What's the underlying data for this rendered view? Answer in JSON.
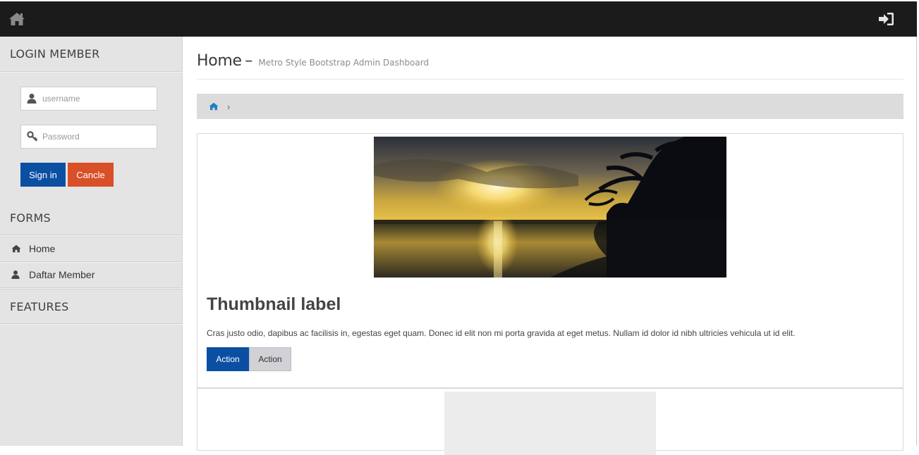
{
  "topbar": {
    "home_icon": "home-icon",
    "signin_icon": "sign-in-icon"
  },
  "sidebar": {
    "login_heading": "LOGIN MEMBER",
    "username_placeholder": "username",
    "password_placeholder": "Password",
    "signin_label": "Sign in",
    "cancel_label": "Cancle",
    "forms_heading": "FORMS",
    "items": [
      {
        "label": "Home",
        "icon": "home-icon"
      },
      {
        "label": "Daftar Member",
        "icon": "user-icon"
      }
    ],
    "features_heading": "FEATURES"
  },
  "main": {
    "title": "Home",
    "title_dash": "–",
    "subtitle": "Metro Style Bootstrap Admin Dashboard",
    "breadcrumb_sep": "›",
    "thumbnail": {
      "label": "Thumbnail label",
      "text": "Cras justo odio, dapibus ac facilisis in, egestas eget quam. Donec id elit non mi porta gravida at eget metus. Nullam id dolor id nibh ultricies vehicula ut id elit.",
      "action1": "Action",
      "action2": "Action"
    }
  },
  "colors": {
    "primary": "#0b4fa3",
    "danger": "#d94f28",
    "topbar": "#1b1b1b",
    "sidebar": "#e4e4e4",
    "breadcrumb_icon": "#1e7fc6"
  }
}
